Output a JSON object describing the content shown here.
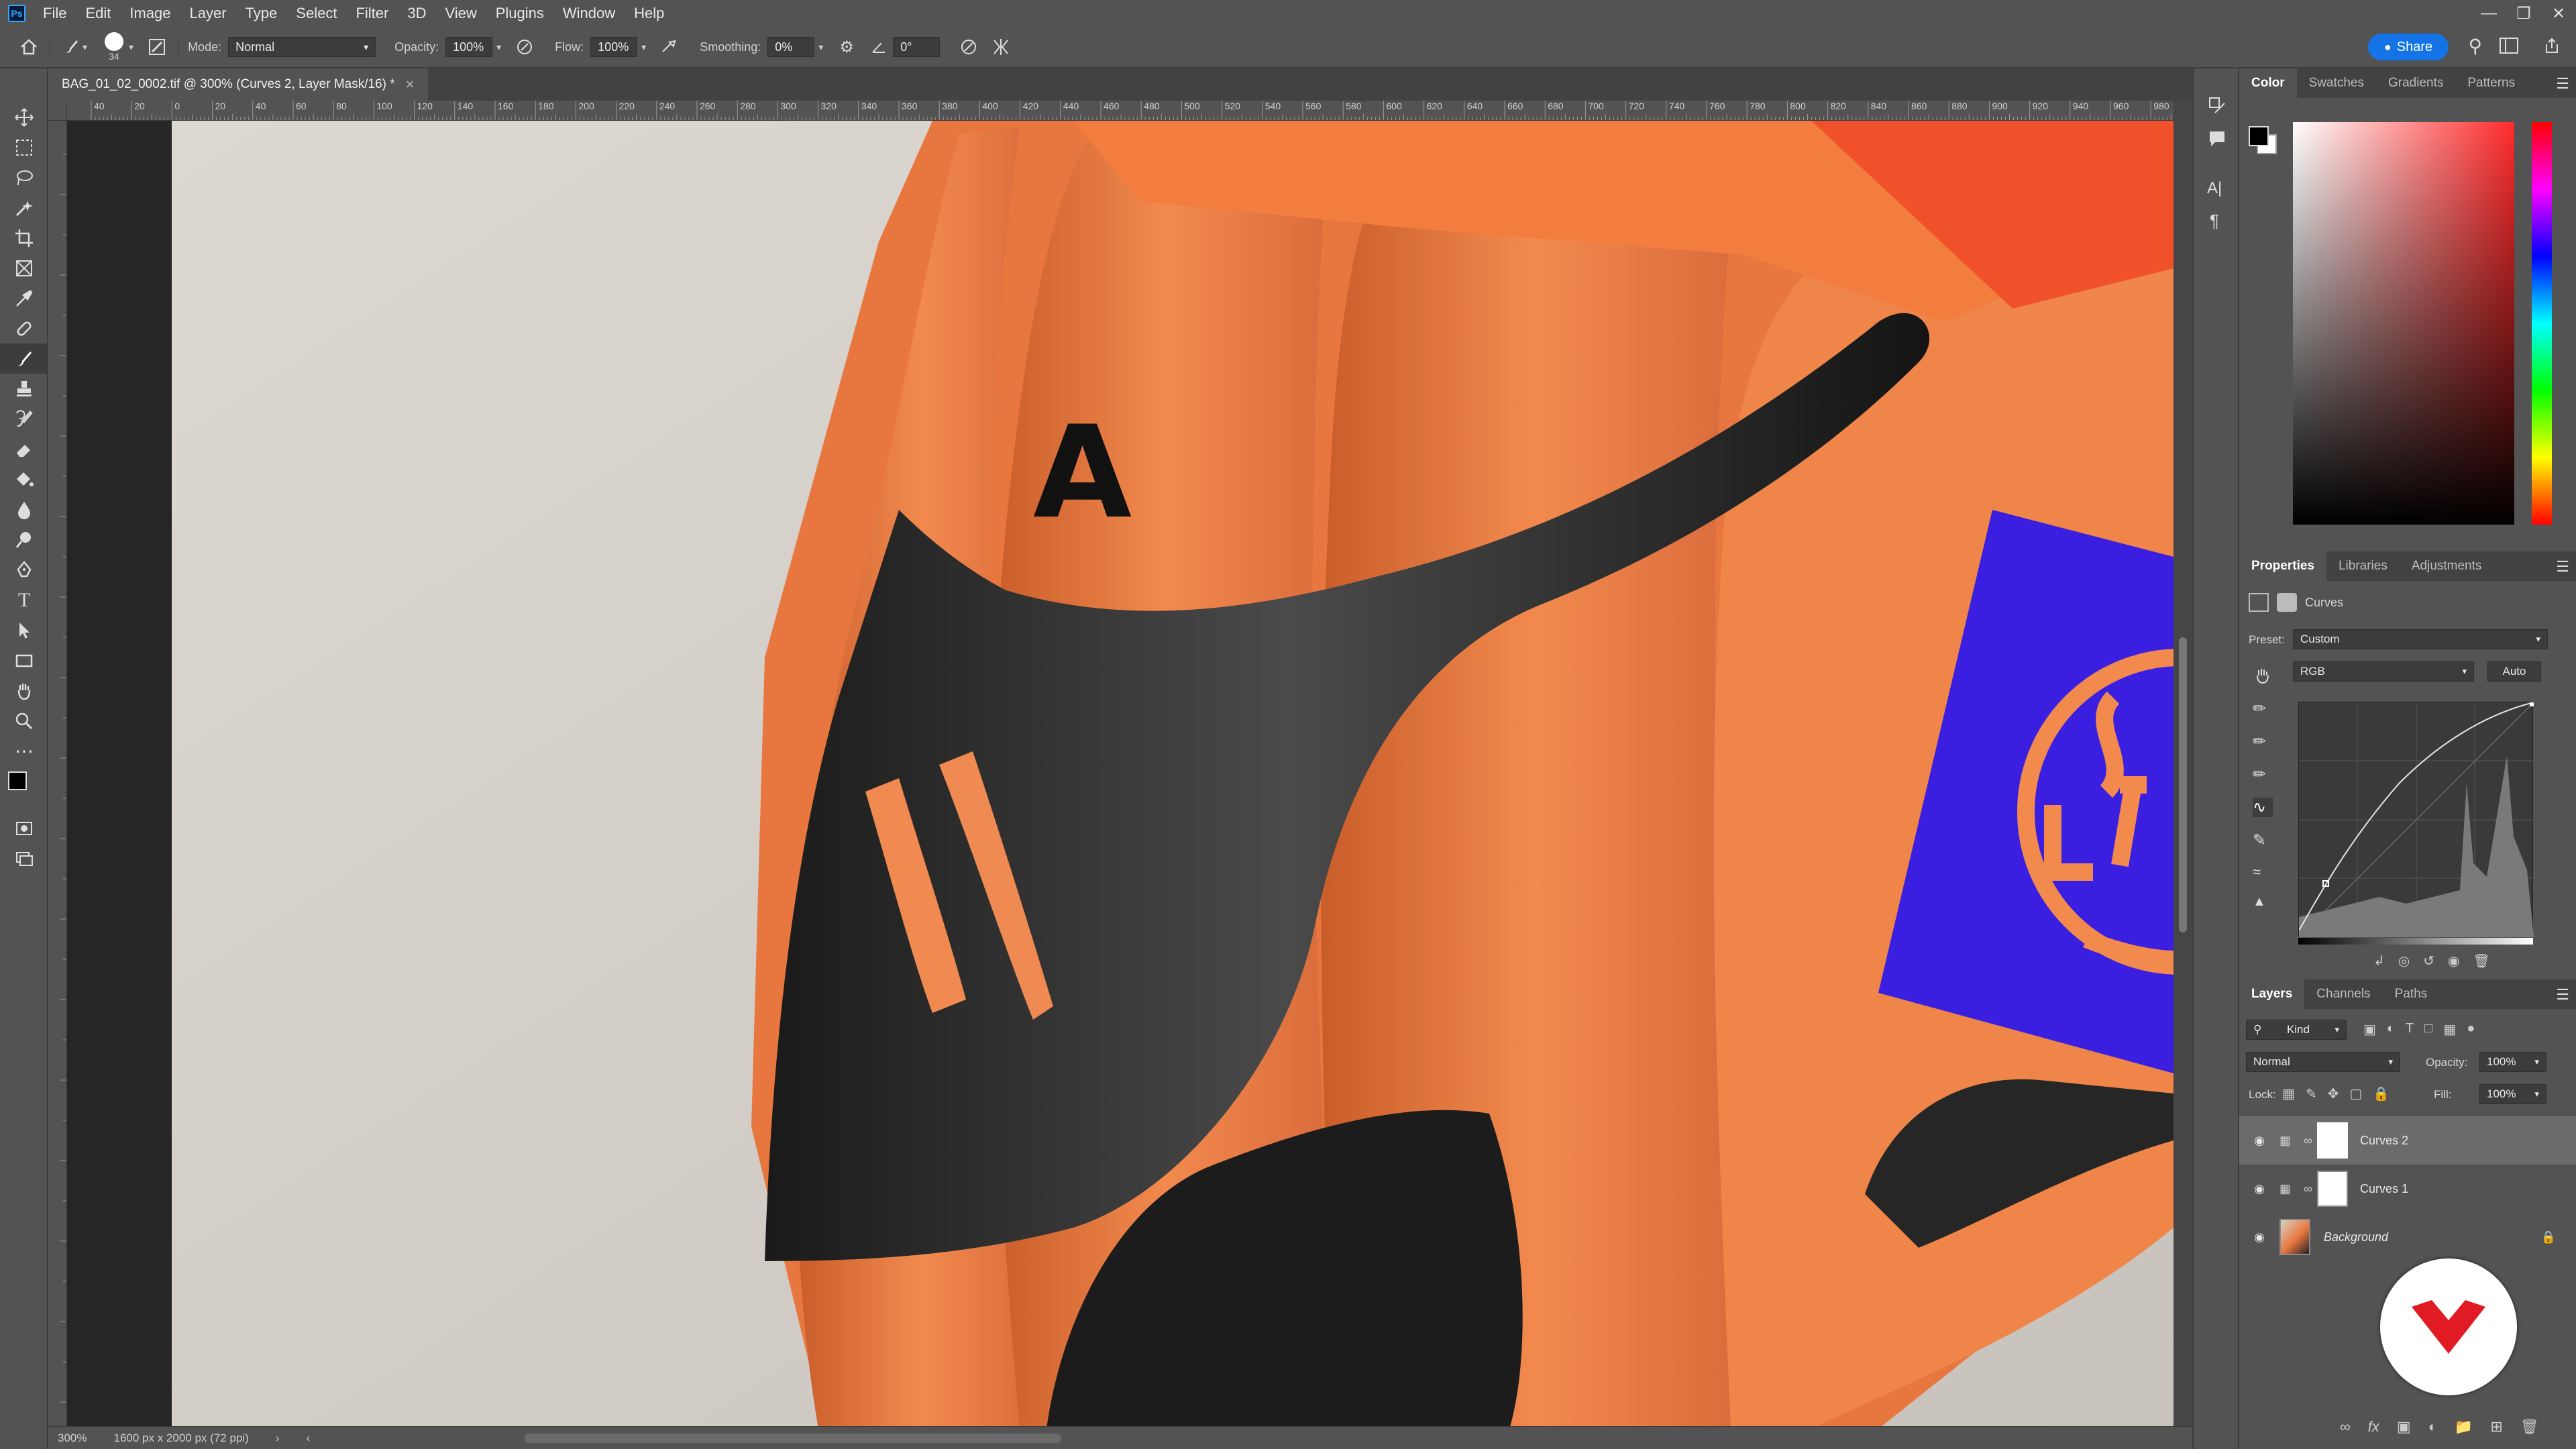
{
  "app": {
    "logo": "Ps"
  },
  "menu": [
    "File",
    "Edit",
    "Image",
    "Layer",
    "Type",
    "Select",
    "Filter",
    "3D",
    "View",
    "Plugins",
    "Window",
    "Help"
  ],
  "window_controls": [
    "minimize-icon",
    "restore-icon",
    "close-icon"
  ],
  "options": {
    "brush_size": "34",
    "mode_label": "Mode:",
    "mode_value": "Normal",
    "opacity_label": "Opacity:",
    "opacity_value": "100%",
    "flow_label": "Flow:",
    "flow_value": "100%",
    "smoothing_label": "Smoothing:",
    "smoothing_value": "0%",
    "angle_value": "0°",
    "share_label": "Share"
  },
  "document": {
    "tab_title": "BAG_01_02_0002.tif @ 300% (Curves 2, Layer Mask/16) *",
    "close": "×",
    "zoom": "300%",
    "doc_info": "1600 px x 2000 px (72 ppi)"
  },
  "ruler_h_labels": [
    "40",
    "20",
    "0",
    "20",
    "40",
    "60",
    "80",
    "100",
    "120",
    "140",
    "160",
    "180",
    "200",
    "220",
    "240",
    "260",
    "280",
    "300",
    "320",
    "340",
    "360",
    "380",
    "400",
    "420",
    "440",
    "460",
    "480",
    "500",
    "520",
    "540",
    "560",
    "580",
    "600",
    "620",
    "640",
    "660",
    "680",
    "700",
    "720",
    "740",
    "760",
    "780",
    "800",
    "820",
    "840",
    "860",
    "880",
    "900",
    "920",
    "940",
    "960",
    "980"
  ],
  "color_panel": {
    "tabs": [
      "Color",
      "Swatches",
      "Gradients",
      "Patterns"
    ],
    "active": "Color",
    "accent": "#ff2b2b"
  },
  "properties_panel": {
    "tabs": [
      "Properties",
      "Libraries",
      "Adjustments"
    ],
    "active": "Properties",
    "title": "Curves",
    "preset_label": "Preset:",
    "preset_value": "Custom",
    "channel_value": "RGB",
    "auto_label": "Auto"
  },
  "layers_panel": {
    "tabs": [
      "Layers",
      "Channels",
      "Paths"
    ],
    "active": "Layers",
    "filter_kind": "Kind",
    "blend_mode": "Normal",
    "opacity_label": "Opacity:",
    "opacity_value": "100%",
    "lock_label": "Lock:",
    "fill_label": "Fill:",
    "fill_value": "100%",
    "layers": [
      {
        "name": "Curves 2",
        "selected": true
      },
      {
        "name": "Curves 1",
        "selected": false
      },
      {
        "name": "Background",
        "selected": false
      }
    ]
  },
  "canvas_text": {
    "letter": "A"
  }
}
